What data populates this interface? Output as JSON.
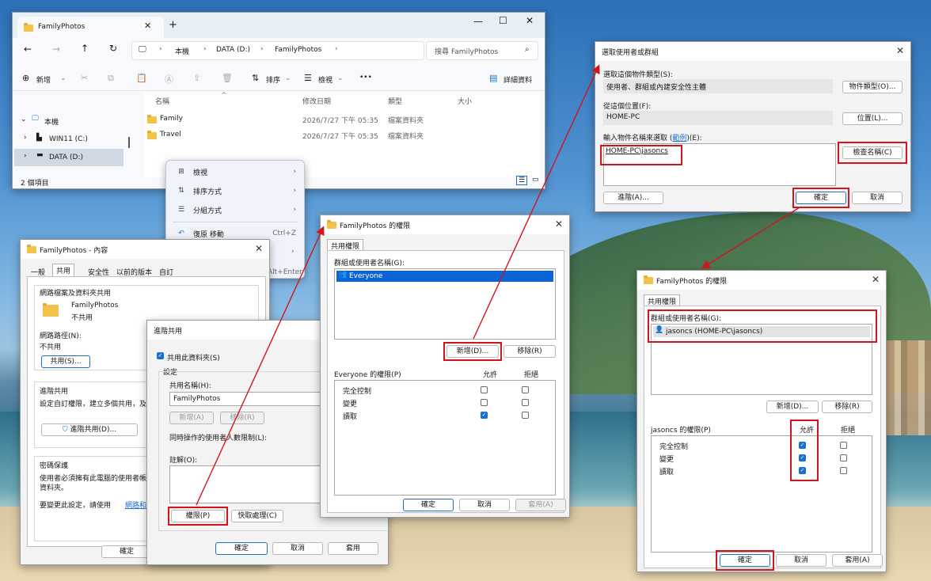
{
  "explorer": {
    "tab_title": "FamilyPhotos",
    "new_tab": "+",
    "breadcrumb": [
      "本機",
      "DATA (D:)",
      "FamilyPhotos"
    ],
    "search_placeholder": "搜尋 FamilyPhotos",
    "toolbar": {
      "new": "新增",
      "sort": "排序",
      "view": "檢視",
      "more": "•••",
      "details": "詳細資料"
    },
    "columns": [
      "名稱",
      "修改日期",
      "類型",
      "大小"
    ],
    "files": [
      {
        "name": "Family",
        "date": "2026/7/27 下午 05:35",
        "type": "檔案資料夾"
      },
      {
        "name": "Travel",
        "date": "2026/7/27 下午 05:35",
        "type": "檔案資料夾"
      }
    ],
    "nav": [
      "本機",
      "WIN11 (C:)",
      "DATA (D:)"
    ],
    "status": "2 個項目"
  },
  "context_menu": {
    "items": [
      {
        "label": "檢視",
        "icon": "⊞",
        "arrow": "›"
      },
      {
        "label": "排序方式",
        "icon": "⇅",
        "arrow": "›"
      },
      {
        "label": "分組方式",
        "icon": "☰",
        "arrow": "›"
      },
      {
        "label": "復原 移動",
        "icon": "↶",
        "shortcut": "Ctrl+Z"
      }
    ],
    "partial_arrow": "›",
    "partial_shortcut": "Alt+Enter"
  },
  "properties": {
    "title": "FamilyPhotos - 內容",
    "tabs": [
      "一般",
      "共用",
      "安全性",
      "以前的版本",
      "自訂"
    ],
    "net_group": "網路檔案及資料夾共用",
    "folder_name": "FamilyPhotos",
    "folder_status": "不共用",
    "net_path_label": "網路路徑(N):",
    "net_path_value": "不共用",
    "share_btn": "共用(S)...",
    "adv_group": "進階共用",
    "adv_desc": "設定自訂權限，建立多個共用，及",
    "adv_btn": "進階共用(D)...",
    "pwd_group": "密碼保護",
    "pwd_desc1": "使用者必須擁有此電腦的使用者帳",
    "pwd_desc2": "資料夾。",
    "pwd_desc3": "要變更此設定，請使用",
    "pwd_link": "網路和共用",
    "ok": "確定"
  },
  "adv_share": {
    "title": "進階共用",
    "share_check": "共用此資料夾(S)",
    "settings": "設定",
    "share_name_label": "共用名稱(H):",
    "share_name_value": "FamilyPhotos",
    "add": "新增(A)",
    "remove": "移除(R)",
    "limit": "同時操作的使用者人數限制(L):",
    "comment": "註解(O):",
    "perm_btn": "權限(P)",
    "cache_btn": "快取處理(C)",
    "ok": "確定",
    "cancel": "取消",
    "apply": "套用"
  },
  "perm1": {
    "title": "FamilyPhotos 的權限",
    "tab": "共用權限",
    "group_label": "群組或使用者名稱(G):",
    "user": "Everyone",
    "add": "新增(D)...",
    "remove": "移除(R)",
    "perm_label": "Everyone 的權限(P)",
    "allow": "允許",
    "deny": "拒絕",
    "rows": [
      "完全控制",
      "變更",
      "讀取"
    ],
    "ok": "確定",
    "cancel": "取消",
    "apply": "套用(A)"
  },
  "select_user": {
    "title": "選取使用者或群組",
    "type_label": "選取這個物件類型(S):",
    "type_value": "使用者、群組或內建安全性主體",
    "type_btn": "物件類型(O)...",
    "loc_label": "從這個位置(F):",
    "loc_value": "HOME-PC",
    "loc_btn": "位置(L)...",
    "enter_label": "輸入物件名稱來選取",
    "enter_link": "範例",
    "enter_suffix": "(E):",
    "entered": "HOME-PC\\jasoncs",
    "check_btn": "檢查名稱(C)",
    "advanced": "進階(A)...",
    "ok": "確定",
    "cancel": "取消"
  },
  "perm2": {
    "title": "FamilyPhotos 的權限",
    "tab": "共用權限",
    "group_label": "群組或使用者名稱(G):",
    "user": "jasoncs (HOME-PC\\jasoncs)",
    "add": "新增(D)...",
    "remove": "移除(R)",
    "perm_label": "jasoncs 的權限(P)",
    "allow": "允許",
    "deny": "拒絕",
    "rows": [
      "完全控制",
      "變更",
      "讀取"
    ],
    "ok": "確定",
    "cancel": "取消",
    "apply": "套用(A)"
  },
  "colors": {
    "highlight": "#d4141c",
    "accent": "#1a6fd0",
    "selection": "#0a64d6"
  }
}
